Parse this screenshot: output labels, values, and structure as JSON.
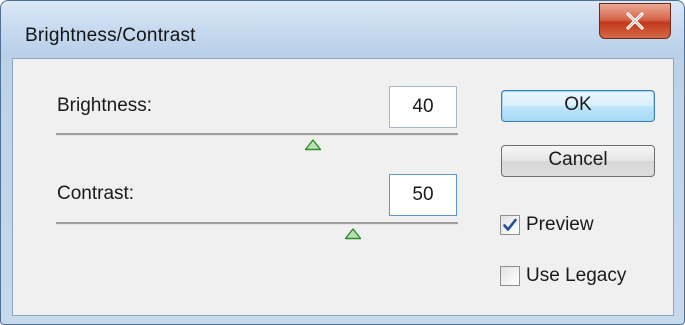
{
  "window": {
    "title": "Brightness/Contrast"
  },
  "brightness": {
    "label": "Brightness:",
    "value": "40",
    "slider_fraction": 0.64
  },
  "contrast": {
    "label": "Contrast:",
    "value": "50",
    "slider_fraction": 0.74
  },
  "buttons": {
    "ok_label": "OK",
    "cancel_label": "Cancel"
  },
  "options": {
    "preview_label": "Preview",
    "preview_checked": true,
    "legacy_label": "Use Legacy",
    "legacy_checked": false
  },
  "icons": {
    "close": "close-icon",
    "thumb": "slider-thumb-icon",
    "check": "checkmark-icon"
  },
  "colors": {
    "close_button": "#c3381c",
    "slider_thumb": "#2e8b2e",
    "checkmark": "#1f4e9c"
  }
}
